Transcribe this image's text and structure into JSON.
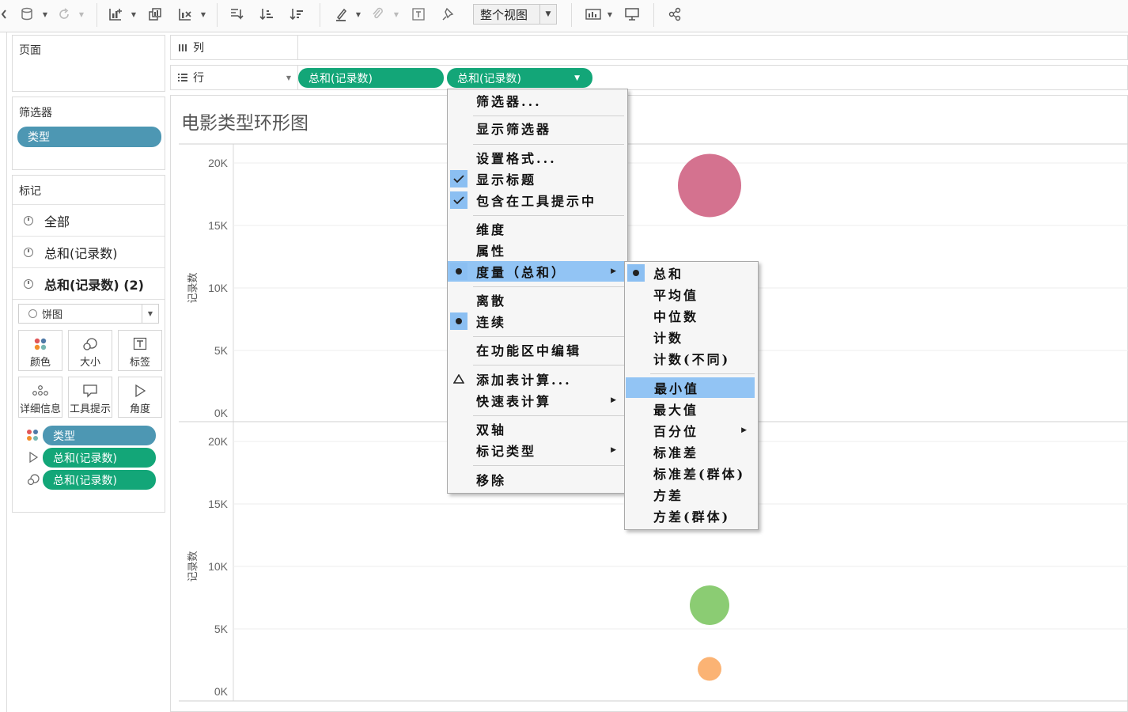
{
  "toolbar": {
    "view_select": "整个视图",
    "icons": [
      "new-worksheet-icon",
      "duplicate-icon",
      "clear-icon",
      "swap-icon",
      "sort-asc-icon",
      "sort-desc-icon",
      "highlight-icon",
      "group-icon",
      "label-icon",
      "pin-icon",
      "show-me-icon",
      "presentation-icon",
      "share-icon",
      "datasource-icon",
      "refresh-icon"
    ]
  },
  "pages_pane": {
    "title": "页面"
  },
  "filters_pane": {
    "title": "筛选器",
    "pill": "类型"
  },
  "marks_pane": {
    "title": "标记",
    "rows": [
      "全部",
      "总和(记录数)",
      "总和(记录数) (2)"
    ],
    "mark_type": "饼图",
    "buttons": [
      "颜色",
      "大小",
      "标签",
      "详细信息",
      "工具提示",
      "角度"
    ],
    "pills": [
      "类型",
      "总和(记录数)",
      "总和(记录数)"
    ]
  },
  "shelves": {
    "columns_label": "列",
    "rows_label": "行",
    "row_pills": [
      "总和(记录数)",
      "总和(记录数)"
    ]
  },
  "chart_data": {
    "type": "scatter",
    "title": "电影类型环形图",
    "panes": [
      {
        "ylabel": "记录数",
        "ylim": [
          0,
          20000
        ],
        "yticks": [
          "20K",
          "15K",
          "10K",
          "5K",
          "0K"
        ],
        "points": [
          {
            "y": 18200,
            "color": "#d4728f",
            "size": "large"
          }
        ]
      },
      {
        "ylabel": "记录数",
        "ylim": [
          0,
          20000
        ],
        "yticks": [
          "20K",
          "15K",
          "10K",
          "5K",
          "0K"
        ],
        "points": [
          {
            "y": 6900,
            "color": "#8bcc73",
            "size": "medium"
          },
          {
            "y": 1800,
            "color": "#fbb374",
            "size": "small"
          }
        ]
      }
    ],
    "grid": true
  },
  "context_menu": {
    "items": [
      {
        "label": "筛选器..."
      },
      {
        "label": "显示筛选器"
      },
      {
        "label": "设置格式..."
      },
      {
        "label": "显示标题",
        "checked": true
      },
      {
        "label": "包含在工具提示中",
        "checked": true
      },
      {
        "label": "维度"
      },
      {
        "label": "属性"
      },
      {
        "label": "度量（总和）",
        "selected_dot": true,
        "highlighted": true,
        "submenu": true
      },
      {
        "label": "离散"
      },
      {
        "label": "连续",
        "selected_dot": true
      },
      {
        "label": "在功能区中编辑"
      },
      {
        "label": "添加表计算...",
        "delta": true
      },
      {
        "label": "快速表计算",
        "submenu": true
      },
      {
        "label": "双轴"
      },
      {
        "label": "标记类型",
        "submenu": true
      },
      {
        "label": "移除"
      }
    ]
  },
  "sub_menu": {
    "items": [
      {
        "label": "总和",
        "selected_dot": true
      },
      {
        "label": "平均值"
      },
      {
        "label": "中位数"
      },
      {
        "label": "计数"
      },
      {
        "label": "计数(不同)"
      },
      {
        "label": "最小值",
        "highlighted": true
      },
      {
        "label": "最大值"
      },
      {
        "label": "百分位",
        "submenu": true
      },
      {
        "label": "标准差"
      },
      {
        "label": "标准差(群体)"
      },
      {
        "label": "方差"
      },
      {
        "label": "方差(群体)"
      }
    ]
  }
}
